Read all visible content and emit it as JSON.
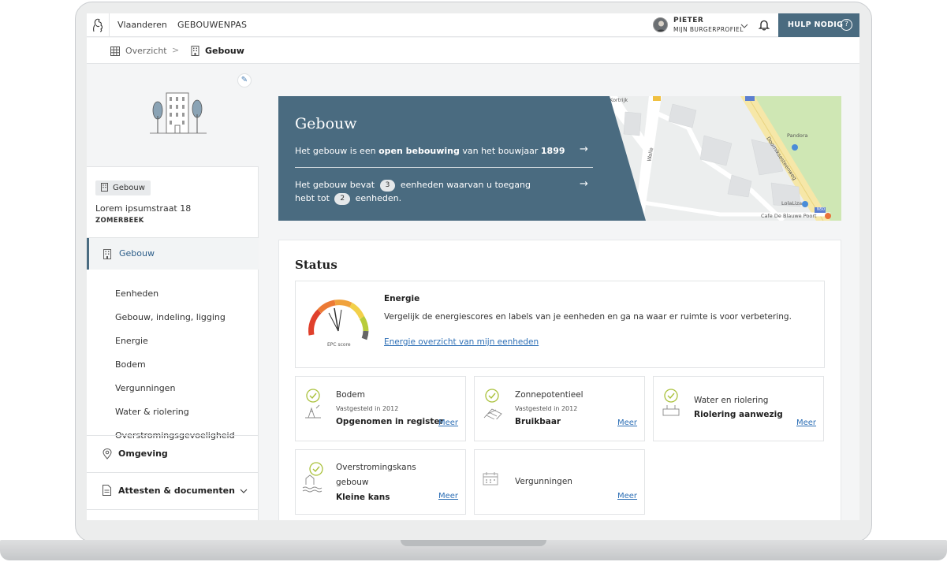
{
  "topbar": {
    "brand": "Vlaanderen",
    "app": "GEBOUWENPAS",
    "user_name": "PIETER",
    "user_profile": "MIJN BURGERPROFIEL",
    "help_label": "HULP NODIG",
    "help_icon": "?"
  },
  "breadcrumb": {
    "overview": "Overzicht",
    "separator": ">",
    "current": "Gebouw"
  },
  "sidebar": {
    "edit_icon": "✎",
    "tag": "Gebouw",
    "address": "Lorem ipsumstraat 18",
    "city": "ZOMERBEEK",
    "active_item": "Gebouw",
    "sub_items": [
      "Eenheden",
      "Gebouw, indeling, ligging",
      "Energie",
      "Bodem",
      "Vergunningen",
      "Water & riolering",
      "Overstromingsgevoeligheid"
    ],
    "omgeving": "Omgeving",
    "attesten": "Attesten & documenten"
  },
  "banner": {
    "title": "Gebouw",
    "row1_pre": "Het gebouw is een ",
    "row1_bold": "open bebouwing",
    "row1_mid": " van het bouwjaar ",
    "row1_year": "1899",
    "row2_pre": "Het gebouw bevat",
    "row2_count1": "3",
    "row2_mid": "eenheden waarvan u toegang hebt tot",
    "row2_count2": "2",
    "row2_post": "eenheden.",
    "arrow": "→",
    "map_labels": {
      "kortrijk": "Kortrijk",
      "walle": "Walle",
      "pandora": "Pandora",
      "doorniksesteenweg": "Doorniksesteenweg",
      "lolaliza": "LolaLiza",
      "cafe": "Cafe De Blauwe Poort",
      "road_n50": "N50"
    }
  },
  "status": {
    "title": "Status",
    "energy": {
      "title": "Energie",
      "description": "Vergelijk de energiescores en labels van je eenheden en ga na waar er ruimte is voor verbetering.",
      "link": "Energie overzicht van mijn eenheden",
      "gauge_label": "EPC score"
    },
    "tiles": [
      {
        "title": "Bodem",
        "sub": "Vastgesteld in 2012",
        "value": "Opgenomen in register",
        "more": "Meer"
      },
      {
        "title": "Zonnepotentieel",
        "sub": "Vastgesteld in 2012",
        "value": "Bruikbaar",
        "more": "Meer"
      },
      {
        "title": "Water en riolering",
        "value": "Riolering aanwezig",
        "more": "Meer"
      },
      {
        "title": "Overstromingskans",
        "title2": "gebouw",
        "value": "Kleine kans",
        "more": "Meer"
      },
      {
        "title": "Vergunningen",
        "more": "Meer"
      }
    ]
  },
  "colors": {
    "brand": "#4a6b80",
    "link": "#2c6eb5",
    "check": "#a9c13a"
  }
}
